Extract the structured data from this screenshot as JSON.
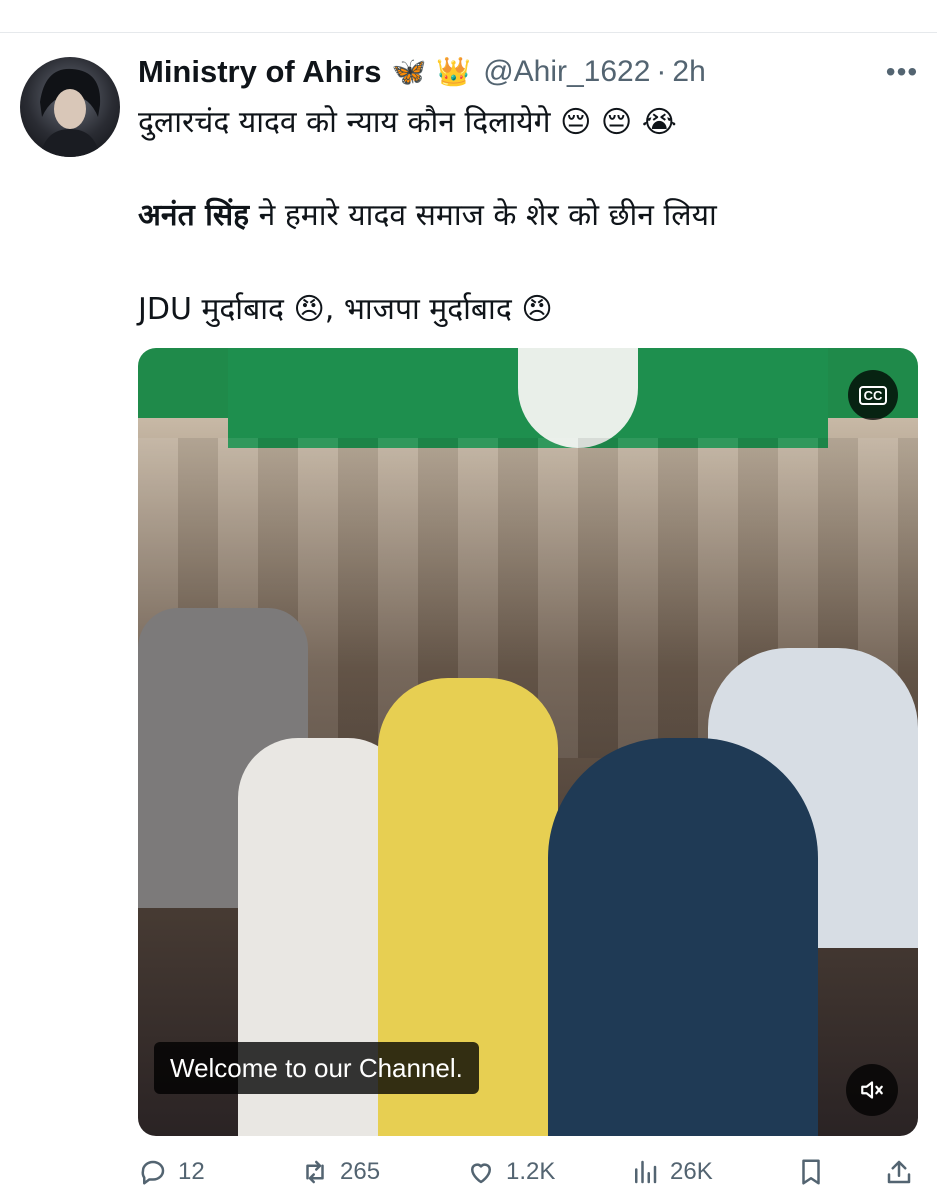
{
  "tweet": {
    "author_name": "Ministry of Ahirs",
    "badges": [
      "🦋",
      "👑"
    ],
    "handle": "@Ahir_1622",
    "separator": "·",
    "time": "2h",
    "more_label": "•••",
    "line1_text": "दुलारचंद यादव को न्याय कौन दिलायेगे",
    "line1_emojis": "😔 😔 😭",
    "line2_bold": "अनंत सिंह",
    "line2_text": " ने हमारे यादव समाज के शेर को छीन लिया",
    "line3_part1": "JDU मुर्दाबाद",
    "line3_emoji1": "😠",
    "line3_part2": ", भाजपा मुर्दाबाद",
    "line3_emoji2": "😠"
  },
  "media": {
    "cc_label": "CC",
    "caption": "Welcome to our Channel."
  },
  "actions": {
    "replies": "12",
    "reposts": "265",
    "likes": "1.2K",
    "views": "26K"
  },
  "icons": {
    "reply": "reply-icon",
    "repost": "repost-icon",
    "like": "heart-icon",
    "views": "views-icon",
    "bookmark": "bookmark-icon",
    "share": "share-icon",
    "mute": "muted-speaker-icon",
    "captions": "closed-captions-icon"
  },
  "colors": {
    "text_primary": "#0f1419",
    "text_secondary": "#536471"
  }
}
